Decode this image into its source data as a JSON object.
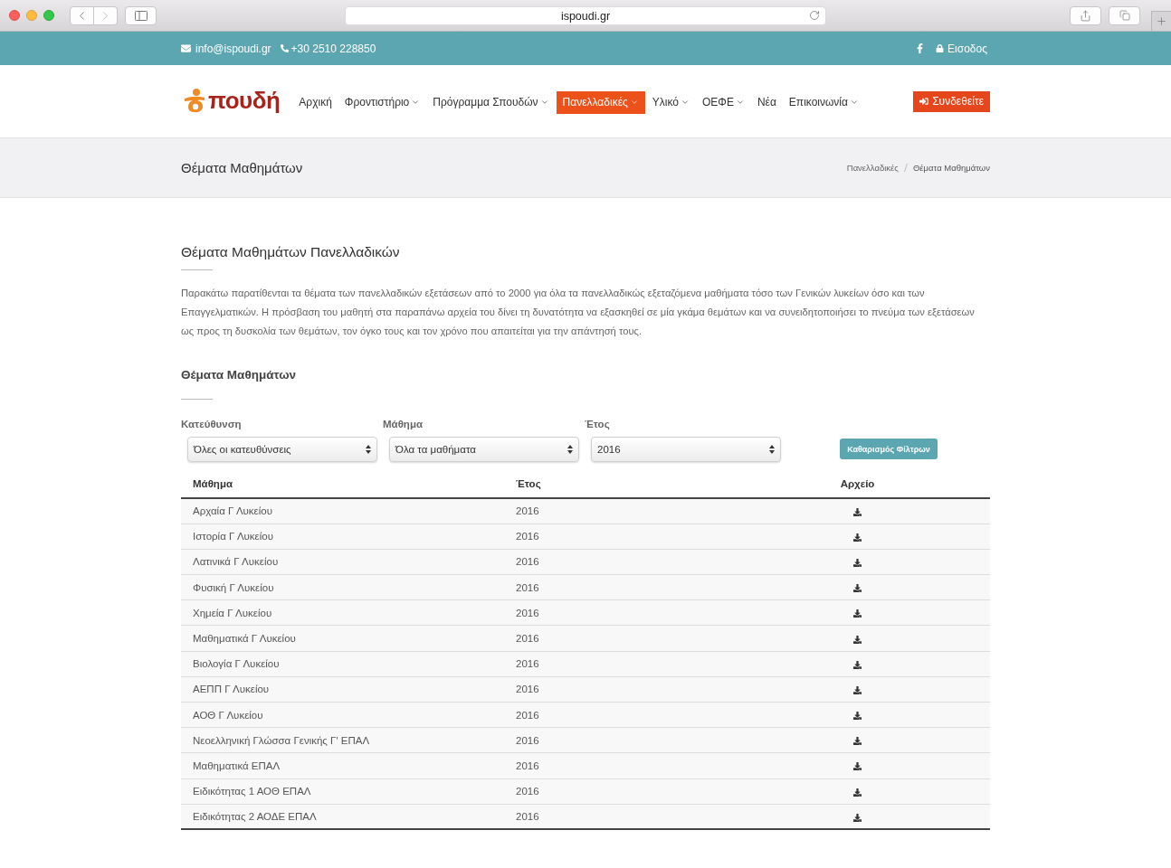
{
  "browser": {
    "url": "ispoudi.gr"
  },
  "topbar": {
    "email": "info@ispoudi.gr",
    "phone": "+30 2510 228850",
    "login": "Εισοδος"
  },
  "nav": {
    "logo_text": "πουδή",
    "items": [
      {
        "label": "Αρχική",
        "has_menu": false,
        "selected": false
      },
      {
        "label": "Φροντιστήριο",
        "has_menu": true,
        "selected": false
      },
      {
        "label": "Πρόγραμμα Σπουδών",
        "has_menu": true,
        "selected": false
      },
      {
        "label": "Πανελλαδικές",
        "has_menu": true,
        "selected": true
      },
      {
        "label": "Υλικό",
        "has_menu": true,
        "selected": false
      },
      {
        "label": "ΟΕΦΕ",
        "has_menu": true,
        "selected": false
      },
      {
        "label": "Νέα",
        "has_menu": false,
        "selected": false
      },
      {
        "label": "Επικοινωνία",
        "has_menu": true,
        "selected": false
      }
    ],
    "signin_button": "Συνδεθείτε"
  },
  "page_header": {
    "title": "Θέματα Μαθημάτων",
    "breadcrumb": [
      "Πανελλαδικές",
      "Θέματα Μαθημάτων"
    ]
  },
  "intro": {
    "title": "Θέματα Μαθημάτων Πανελλαδικών",
    "text": "Παρακάτω παρατίθενται τα θέματα των πανελλαδικών εξετάσεων από το 2000 για όλα τα πανελλαδικώς εξεταζόμενα μαθήματα τόσο των Γενικών λυκείων όσο και των Επαγγελματικών. Η πρόσβαση του μαθητή στα παραπάνω αρχεία του δίνει τη δυνατότητα να εξασκηθεί σε μία γκάμα θεμάτων και να συνειδητοποιήσει το πνεύμα των εξετάσεων ως προς τη δυσκολία των θεμάτων, τον όγκο τους και τον χρόνο που απαιτείται για την απάντησή τους."
  },
  "filters": {
    "title": "Θέματα Μαθημάτων",
    "fields": [
      {
        "label": "Κατεύθυνση",
        "value": "Όλες οι κατευθύνσεις"
      },
      {
        "label": "Μάθημα",
        "value": "Όλα τα μαθήματα"
      },
      {
        "label": "Έτος",
        "value": "2016"
      }
    ],
    "clear_button": "Καθαρισμός Φίλτρων"
  },
  "table": {
    "columns": [
      "Μάθημα",
      "Έτος",
      "Αρχείο"
    ],
    "rows": [
      {
        "subject": "Αρχαία Γ Λυκείου",
        "year": "2016"
      },
      {
        "subject": "Ιστορία Γ Λυκείου",
        "year": "2016"
      },
      {
        "subject": "Λατινικά Γ Λυκείου",
        "year": "2016"
      },
      {
        "subject": "Φυσική Γ Λυκείου",
        "year": "2016"
      },
      {
        "subject": "Χημεία Γ Λυκείου",
        "year": "2016"
      },
      {
        "subject": "Μαθηματικά Γ Λυκείου",
        "year": "2016"
      },
      {
        "subject": "Βιολογία Γ Λυκείου",
        "year": "2016"
      },
      {
        "subject": "ΑΕΠΠ Γ Λυκείου",
        "year": "2016"
      },
      {
        "subject": "ΑΟΘ Γ Λυκείου",
        "year": "2016"
      },
      {
        "subject": "Νεοελληνική Γλώσσα Γενικής Γ' ΕΠΑΛ",
        "year": "2016"
      },
      {
        "subject": "Μαθηματικά ΕΠΑΛ",
        "year": "2016"
      },
      {
        "subject": "Ειδικότητας 1 ΑΟΘ ΕΠΑΛ",
        "year": "2016"
      },
      {
        "subject": "Ειδικότητας 2 ΑΟΔΕ ΕΠΑΛ",
        "year": "2016"
      }
    ]
  }
}
